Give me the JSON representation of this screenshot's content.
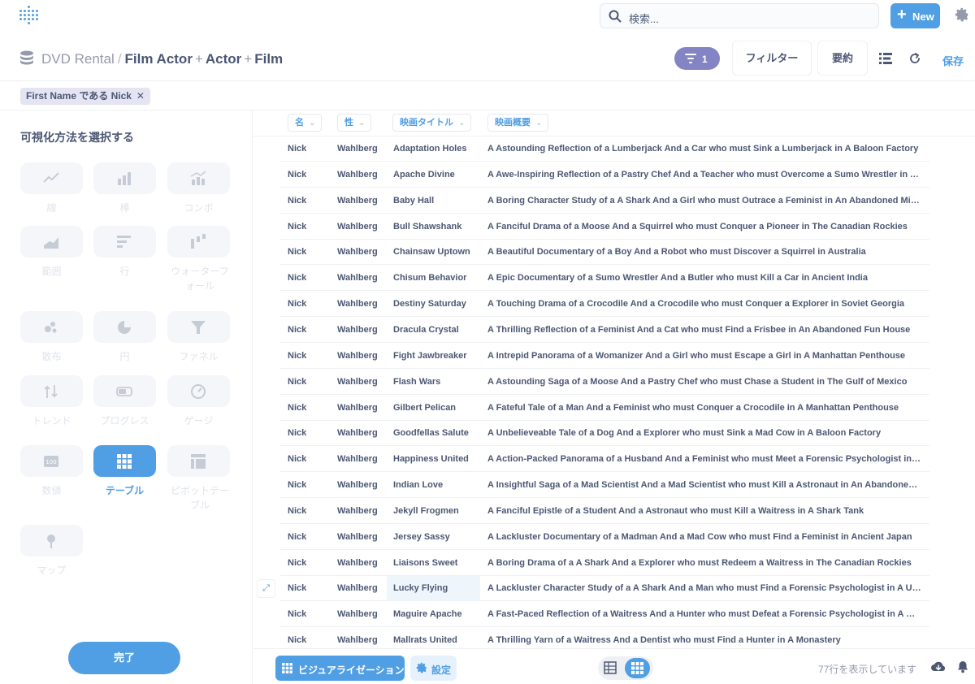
{
  "topbar": {
    "search_placeholder": "検索...",
    "new_label": "New"
  },
  "header": {
    "database": "DVD Rental",
    "tables": [
      "Film Actor",
      "Actor",
      "Film"
    ],
    "filter_count": "1",
    "filter_label": "フィルター",
    "summarize_label": "要約",
    "save_label": "保存"
  },
  "filter_pill": {
    "label": "First Name である Nick",
    "close": "✕"
  },
  "sidebar": {
    "title": "可視化方法を選択する",
    "options": [
      {
        "label": "線",
        "icon": "line-chart-icon"
      },
      {
        "label": "棒",
        "icon": "bar-chart-icon"
      },
      {
        "label": "コンボ",
        "icon": "combo-chart-icon"
      },
      {
        "label": "範囲",
        "icon": "area-chart-icon"
      },
      {
        "label": "行",
        "icon": "row-chart-icon"
      },
      {
        "label": "ウォーターフォール",
        "icon": "waterfall-chart-icon"
      },
      {
        "label": "散布",
        "icon": "scatter-chart-icon"
      },
      {
        "label": "円",
        "icon": "pie-chart-icon"
      },
      {
        "label": "ファネル",
        "icon": "funnel-chart-icon"
      },
      {
        "label": "トレンド",
        "icon": "trend-icon"
      },
      {
        "label": "プログレス",
        "icon": "progress-icon"
      },
      {
        "label": "ゲージ",
        "icon": "gauge-icon"
      },
      {
        "label": "数値",
        "icon": "number-icon"
      },
      {
        "label": "テーブル",
        "icon": "table-icon",
        "active": true
      },
      {
        "label": "ピボットテーブル",
        "icon": "pivot-table-icon"
      },
      {
        "label": "マップ",
        "icon": "map-pin-icon"
      }
    ],
    "done_label": "完了"
  },
  "table": {
    "columns": [
      "名",
      "性",
      "映画タイトル",
      "映画概要"
    ],
    "rows": [
      [
        "Nick",
        "Wahlberg",
        "Adaptation Holes",
        "A Astounding Reflection of a Lumberjack And a Car who must Sink a Lumberjack in A Baloon Factory"
      ],
      [
        "Nick",
        "Wahlberg",
        "Apache Divine",
        "A Awe-Inspiring Reflection of a Pastry Chef And a Teacher who must Overcome a Sumo Wrestler in A U-Boat"
      ],
      [
        "Nick",
        "Wahlberg",
        "Baby Hall",
        "A Boring Character Study of a A Shark And a Girl who must Outrace a Feminist in An Abandoned Mine Shaft"
      ],
      [
        "Nick",
        "Wahlberg",
        "Bull Shawshank",
        "A Fanciful Drama of a Moose And a Squirrel who must Conquer a Pioneer in The Canadian Rockies"
      ],
      [
        "Nick",
        "Wahlberg",
        "Chainsaw Uptown",
        "A Beautiful Documentary of a Boy And a Robot who must Discover a Squirrel in Australia"
      ],
      [
        "Nick",
        "Wahlberg",
        "Chisum Behavior",
        "A Epic Documentary of a Sumo Wrestler And a Butler who must Kill a Car in Ancient India"
      ],
      [
        "Nick",
        "Wahlberg",
        "Destiny Saturday",
        "A Touching Drama of a Crocodile And a Crocodile who must Conquer a Explorer in Soviet Georgia"
      ],
      [
        "Nick",
        "Wahlberg",
        "Dracula Crystal",
        "A Thrilling Reflection of a Feminist And a Cat who must Find a Frisbee in An Abandoned Fun House"
      ],
      [
        "Nick",
        "Wahlberg",
        "Fight Jawbreaker",
        "A Intrepid Panorama of a Womanizer And a Girl who must Escape a Girl in A Manhattan Penthouse"
      ],
      [
        "Nick",
        "Wahlberg",
        "Flash Wars",
        "A Astounding Saga of a Moose And a Pastry Chef who must Chase a Student in The Gulf of Mexico"
      ],
      [
        "Nick",
        "Wahlberg",
        "Gilbert Pelican",
        "A Fateful Tale of a Man And a Feminist who must Conquer a Crocodile in A Manhattan Penthouse"
      ],
      [
        "Nick",
        "Wahlberg",
        "Goodfellas Salute",
        "A Unbelieveable Tale of a Dog And a Explorer who must Sink a Mad Cow in A Baloon Factory"
      ],
      [
        "Nick",
        "Wahlberg",
        "Happiness United",
        "A Action-Packed Panorama of a Husband And a Feminist who must Meet a Forensic Psychologist in Ancient…"
      ],
      [
        "Nick",
        "Wahlberg",
        "Indian Love",
        "A Insightful Saga of a Mad Scientist And a Mad Scientist who must Kill a Astronaut in An Abandoned Fun H…"
      ],
      [
        "Nick",
        "Wahlberg",
        "Jekyll Frogmen",
        "A Fanciful Epistle of a Student And a Astronaut who must Kill a Waitress in A Shark Tank"
      ],
      [
        "Nick",
        "Wahlberg",
        "Jersey Sassy",
        "A Lackluster Documentary of a Madman And a Mad Cow who must Find a Feminist in Ancient Japan"
      ],
      [
        "Nick",
        "Wahlberg",
        "Liaisons Sweet",
        "A Boring Drama of a A Shark And a Explorer who must Redeem a Waitress in The Canadian Rockies"
      ],
      [
        "Nick",
        "Wahlberg",
        "Lucky Flying",
        "A Lackluster Character Study of a A Shark And a Man who must Find a Forensic Psychologist in A U-Boat"
      ],
      [
        "Nick",
        "Wahlberg",
        "Maguire Apache",
        "A Fast-Paced Reflection of a Waitress And a Hunter who must Defeat a Forensic Psychologist in A Baloon"
      ],
      [
        "Nick",
        "Wahlberg",
        "Mallrats United",
        "A Thrilling Yarn of a Waitress And a Dentist who must Find a Hunter in A Monastery"
      ]
    ],
    "highlighted_row": 17
  },
  "footer": {
    "visualization_label": "ビジュアライゼーション",
    "settings_label": "設定",
    "row_count": "77行を表示しています"
  },
  "colors": {
    "accent": "#509ee3",
    "filter_purple": "#8484c4",
    "text": "#4c5773"
  }
}
